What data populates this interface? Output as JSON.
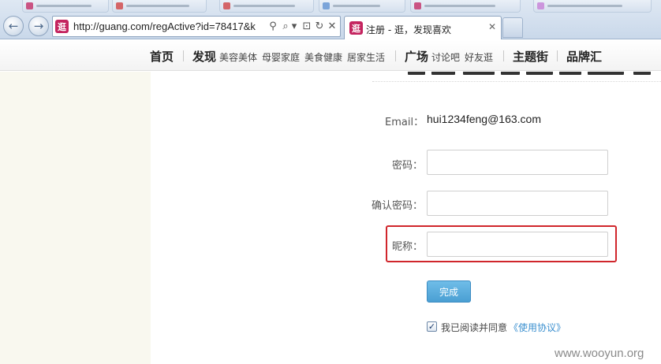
{
  "browser": {
    "url": "http://guang.com/regActive?id=78417&k",
    "tab_title": "注册 - 逛，发现喜欢",
    "favicon_char": "逛",
    "tab_close": "✕",
    "back_icon": "arrow-left",
    "forward_icon": "arrow-right",
    "addr_icons": {
      "compat": "⚲",
      "search": "⌕",
      "dropdown": "▾",
      "view": "⊡",
      "refresh": "↻",
      "stop": "✕"
    }
  },
  "site_nav": {
    "home": "首页",
    "discover": "发现",
    "discover_subs": [
      "美容美体",
      "母婴家庭",
      "美食健康",
      "居家生活"
    ],
    "square": "广场",
    "square_subs": [
      "讨论吧",
      "好友逛"
    ],
    "topic_street": "主题街",
    "brand_hub": "品牌汇"
  },
  "form": {
    "email_label": "Email：",
    "email_value": "hui1234feng@163.com",
    "password_label": "密码：",
    "confirm_password_label": "确认密码：",
    "nickname_label": "昵称：",
    "submit_label": "完成",
    "agree_checked": true,
    "agree_text": "我已阅读并同意",
    "agree_link": "《使用协议》"
  },
  "watermark": "www.wooyun.org",
  "colors": {
    "favicon": "#c4245f",
    "highlight_border": "#d0262c",
    "submit_button": "#4a9fd3",
    "link": "#3a8fcf",
    "left_column_bg": "#f9f8ef"
  }
}
